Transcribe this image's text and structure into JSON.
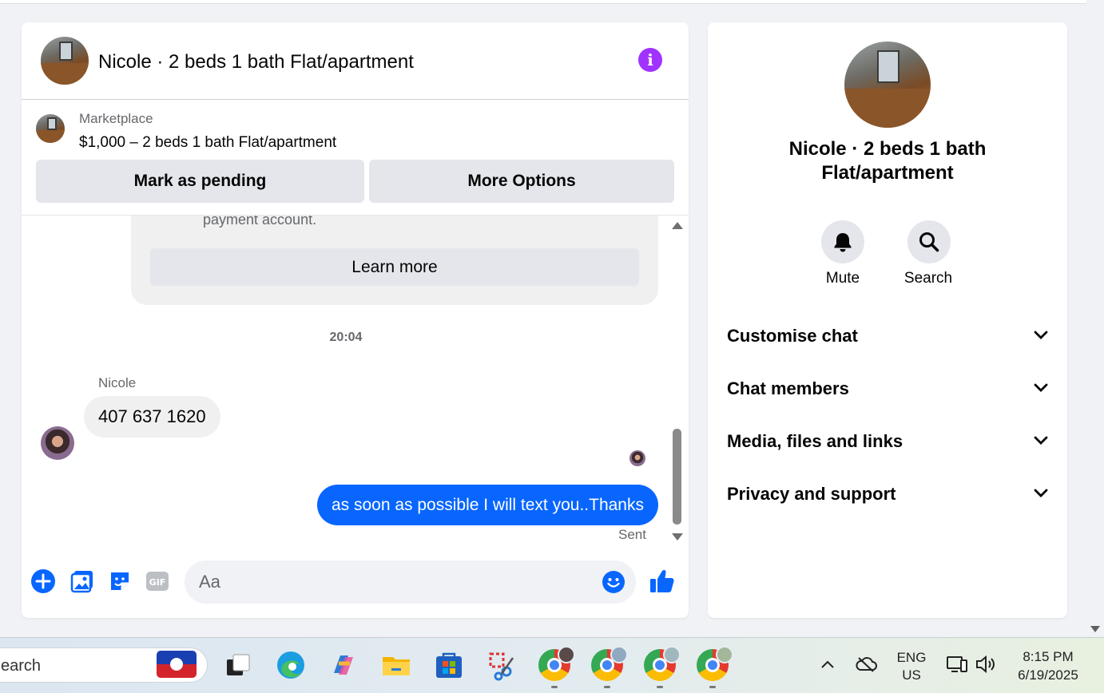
{
  "chat": {
    "title": "Nicole · 2 beds 1 bath Flat/apartment",
    "marketplace_label": "Marketplace",
    "listing_line": "$1,000 – 2 beds 1 bath Flat/apartment",
    "mark_pending_label": "Mark as pending",
    "more_options_label": "More Options",
    "info_card_text": "payment account.",
    "learn_more_label": "Learn more",
    "timestamp": "20:04",
    "sender_name": "Nicole",
    "incoming_message": "407 637 1620",
    "outgoing_message": "as soon as possible I will text you..Thanks",
    "sent_status": "Sent",
    "composer_placeholder": "Aa",
    "accent_color": "#0866ff"
  },
  "side": {
    "title_line1": "Nicole · 2 beds 1 bath",
    "title_line2": "Flat/apartment",
    "mute_label": "Mute",
    "search_label": "Search",
    "sections": [
      "Customise chat",
      "Chat members",
      "Media, files and links",
      "Privacy and support"
    ]
  },
  "taskbar": {
    "search_text": "earch",
    "language_line1": "ENG",
    "language_line2": "US",
    "time": "8:15 PM",
    "date": "6/19/2025"
  },
  "icons": [
    "info-icon",
    "bell-icon",
    "search-icon",
    "chevron-down-icon",
    "plus-icon",
    "photo-icon",
    "sticker-icon",
    "gif-icon",
    "emoji-icon",
    "thumbs-up-icon"
  ]
}
